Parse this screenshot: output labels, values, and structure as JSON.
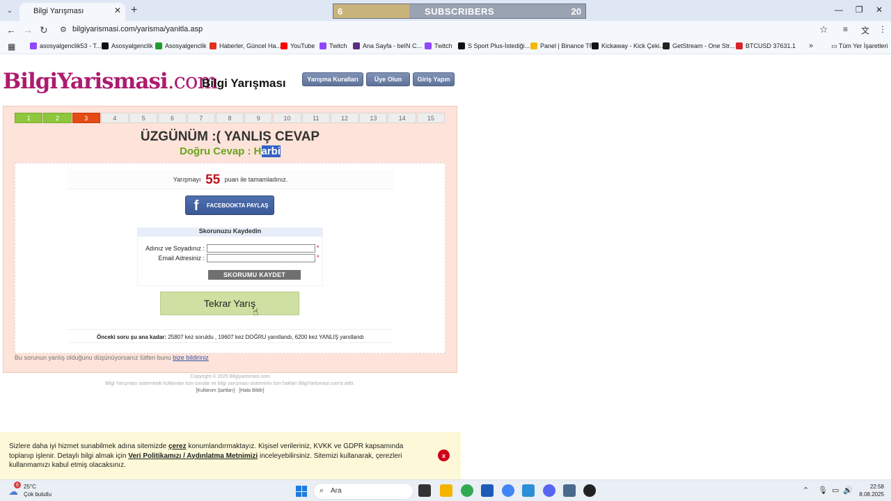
{
  "browser": {
    "tab_title": "Bilgi Yarışması",
    "url": "bilgiyarismasi.com/yarisma/yanitla.asp",
    "subscriber_banner": {
      "count": "6",
      "label": "SUBSCRIBERS",
      "goal": "20",
      "progress": 0.3
    },
    "bookmarks": [
      {
        "label": "asosyalgenclik53 - T...",
        "color": "#9146ff"
      },
      {
        "label": "Asosyalgenclik",
        "color": "#111111"
      },
      {
        "label": "Asosyalgenclik",
        "color": "#1f9d2b"
      },
      {
        "label": "Haberler, Güncel Ha...",
        "color": "#e0301e"
      },
      {
        "label": "YouTube",
        "color": "#ff0000"
      },
      {
        "label": "Twitch",
        "color": "#9146ff"
      },
      {
        "label": "Ana Sayfa - beIN C...",
        "color": "#5a2d82"
      },
      {
        "label": "Twitch",
        "color": "#9146ff"
      },
      {
        "label": "S Sport Plus-İstediği...",
        "color": "#111111"
      },
      {
        "label": "Panel | Binance TR",
        "color": "#f0b90b"
      },
      {
        "label": "Kickaway - Kick Çeki...",
        "color": "#111111"
      },
      {
        "label": "GetStream - One Str...",
        "color": "#222222"
      },
      {
        "label": "BTCUSD 37631.1",
        "color": "#d6262c"
      }
    ],
    "all_bookmarks": "Tüm Yer İşaretleri"
  },
  "header": {
    "logo_main": "BilgiYarismasi",
    "logo_suffix": ".com",
    "site_title": "Bilgi Yarışması",
    "nav": [
      "Yarışma Kuralları",
      "Üye Olun",
      "Giriş Yapın"
    ]
  },
  "quiz": {
    "steps": [
      "1",
      "2",
      "3",
      "4",
      "5",
      "6",
      "7",
      "8",
      "9",
      "10",
      "11",
      "12",
      "13",
      "14",
      "15"
    ],
    "completed_steps": 2,
    "wrong_step": 3,
    "result_title": "ÜZGÜNÜM :(  YANLIŞ CEVAP",
    "correct_prefix": "Doğru Cevap : H",
    "correct_selected": "arbi",
    "score_prefix": "Yarışmayı",
    "score": "55",
    "score_suffix": "puan ile tamamladınız.",
    "facebook_label": "FACEBOOKTA PAYLAŞ",
    "save": {
      "title": "Skorunuzu Kaydedin",
      "name_label": "Adınız ve Soyadınız :",
      "email_label": "Email Adresiniz :",
      "name_value": "",
      "email_value": "",
      "required_mark": "*",
      "button": "SKORUMU KAYDET"
    },
    "retry_label": "Tekrar Yarış",
    "stats_prefix": "Önceki soru şu ana kadar:",
    "stats_text": "25807 kez soruldu , 19607 kez DOĞRU yanıtlandı, 6200 kez YANLIŞ yanıtlandı",
    "report_text": "Bu sorunun yanlış olduğunu düşünüyorsanız lütfen bunu",
    "report_link": "bize bildiriniz"
  },
  "footer": {
    "copyright": "Copyright © 2025 Bilgiyarismasi.com",
    "rights": "Bilgi Yarışması sisteminde kullanılan tüm sorular ve bilgi yarışması sisteminin tüm hakları BilgiYarismasi.com'a aittir.",
    "link1": "[Kullanım Şartları]",
    "sep": " - ",
    "link2": "[Hata Bildir]"
  },
  "cookie": {
    "t1": "Sizlere daha iyi hizmet sunabilmek adına sitemizde ",
    "b1": "çerez",
    "t2": " konumlandırmaktayız. Kişisel verileriniz, KVKK ve GDPR kapsamında toplanıp işlenir. Detaylı bilgi almak için ",
    "b2": "Veri Politikamızı / Aydınlatma Metnimizi",
    "t3": " inceleyebilirsiniz. Sitemizi kullanarak, çerezleri kullanmamızı kabul etmiş olacaksınız.",
    "close": "x"
  },
  "taskbar": {
    "weather_badge": "6",
    "temperature": "25°C",
    "weather_desc": "Çok bulutlu",
    "search_placeholder": "Ara",
    "time": "22:58",
    "date": "8.08.2025"
  }
}
